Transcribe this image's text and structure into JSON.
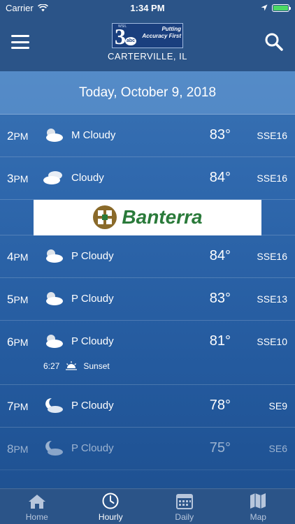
{
  "status": {
    "carrier": "Carrier",
    "time": "1:34 PM"
  },
  "header": {
    "location": "CARTERVILLE, IL",
    "logo_number": "3",
    "logo_network": "abc",
    "logo_station": "WSIL",
    "logo_tagline": "Putting Accuracy First"
  },
  "date": "Today, October 9, 2018",
  "hours": [
    {
      "hour": "2",
      "ampm": "PM",
      "icon": "partly-cloudy-sun-icon",
      "condition": "M Cloudy",
      "temp": "83°",
      "wind": "SSE16"
    },
    {
      "hour": "3",
      "ampm": "PM",
      "icon": "cloudy-icon",
      "condition": "Cloudy",
      "temp": "84°",
      "wind": "SSE16"
    },
    {
      "hour": "4",
      "ampm": "PM",
      "icon": "partly-cloudy-sun-icon",
      "condition": "P Cloudy",
      "temp": "84°",
      "wind": "SSE16"
    },
    {
      "hour": "5",
      "ampm": "PM",
      "icon": "partly-cloudy-sun-icon",
      "condition": "P Cloudy",
      "temp": "83°",
      "wind": "SSE13"
    },
    {
      "hour": "6",
      "ampm": "PM",
      "icon": "partly-cloudy-sun-icon",
      "condition": "P Cloudy",
      "temp": "81°",
      "wind": "SSE10",
      "sunset_time": "6:27",
      "sunset_label": "Sunset"
    },
    {
      "hour": "7",
      "ampm": "PM",
      "icon": "partly-cloudy-moon-icon",
      "condition": "P Cloudy",
      "temp": "78°",
      "wind": "SE9"
    },
    {
      "hour": "8",
      "ampm": "PM",
      "icon": "partly-cloudy-moon-icon",
      "condition": "P Cloudy",
      "temp": "75°",
      "wind": "SE6"
    }
  ],
  "ad": {
    "brand": "Banterra"
  },
  "tabs": [
    {
      "label": "Home",
      "icon": "home-icon"
    },
    {
      "label": "Hourly",
      "icon": "clock-icon"
    },
    {
      "label": "Daily",
      "icon": "calendar-icon"
    },
    {
      "label": "Map",
      "icon": "map-icon"
    }
  ],
  "colors": {
    "header": "#2b5488",
    "battery": "#4cd964",
    "ad_green": "#2a7a3a"
  }
}
